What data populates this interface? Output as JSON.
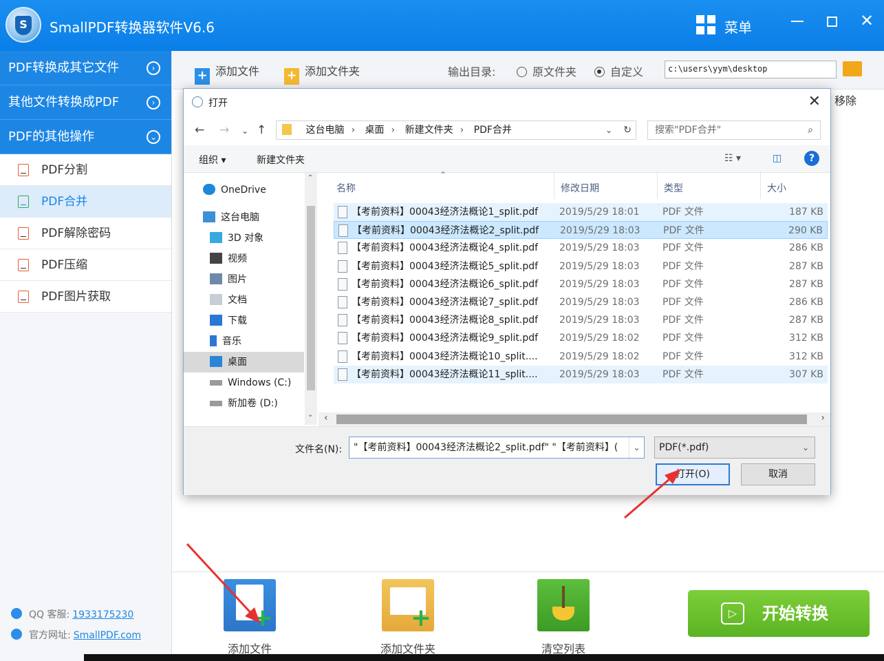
{
  "app": {
    "title": "SmallPDF转换器软件V6.6",
    "logo_letter": "S",
    "menu_label": "菜单",
    "close_glyph": "✕"
  },
  "sidebar": {
    "categories": [
      {
        "label": "PDF转换成其它文件",
        "icon": "chevron-right-circle"
      },
      {
        "label": "其他文件转换成PDF",
        "icon": "chevron-right-circle"
      },
      {
        "label": "PDF的其他操作",
        "icon": "chevron-down-circle"
      }
    ],
    "items": [
      {
        "label": "PDF分割"
      },
      {
        "label": "PDF合并",
        "active": true
      },
      {
        "label": "PDF解除密码"
      },
      {
        "label": "PDF压缩"
      },
      {
        "label": "PDF图片获取"
      }
    ],
    "qq_label": "QQ 客服:",
    "qq_value": "1933175230",
    "site_label": "官方网址:",
    "site_value": "SmallPDF.com"
  },
  "toolbar": {
    "add_file": "添加文件",
    "add_folder": "添加文件夹",
    "output_label": "输出目录:",
    "option_original": "原文件夹",
    "option_custom": "自定义",
    "custom_selected": true,
    "output_path": "c:\\users\\yym\\desktop",
    "remove_header": "移除"
  },
  "bottom": {
    "add_file": "添加文件",
    "add_folder": "添加文件夹",
    "clear_list": "清空列表",
    "start": "开始转换"
  },
  "dialog": {
    "title": "打开",
    "breadcrumb": [
      "这台电脑",
      "桌面",
      "新建文件夹",
      "PDF合并"
    ],
    "search_placeholder": "搜索\"PDF合并\"",
    "organize": "组织 ▾",
    "new_folder": "新建文件夹",
    "nav_items": [
      {
        "label": "OneDrive",
        "icon": "cloud-icon",
        "color": "#1e88d8"
      },
      {
        "label": "这台电脑",
        "icon": "computer-icon",
        "color": "#3d8fd6"
      },
      {
        "label": "3D 对象",
        "icon": "cube-icon",
        "color": "#36a9e0"
      },
      {
        "label": "视频",
        "icon": "film-icon",
        "color": "#444444"
      },
      {
        "label": "图片",
        "icon": "picture-icon",
        "color": "#6d8aa8"
      },
      {
        "label": "文档",
        "icon": "document-icon",
        "color": "#8a98a8"
      },
      {
        "label": "下载",
        "icon": "download-icon",
        "color": "#2b78d4"
      },
      {
        "label": "音乐",
        "icon": "music-icon",
        "color": "#2b78d4"
      },
      {
        "label": "桌面",
        "icon": "desktop-icon",
        "color": "#2b84d8",
        "selected": true
      },
      {
        "label": "Windows (C:)",
        "icon": "drive-icon",
        "color": "#7a7a7a"
      },
      {
        "label": "新加卷 (D:)",
        "icon": "drive-icon",
        "color": "#7a7a7a"
      }
    ],
    "columns": {
      "name": "名称",
      "date": "修改日期",
      "type": "类型",
      "size": "大小"
    },
    "files": [
      {
        "name": "【考前资料】00043经济法概论1_split.pdf",
        "date": "2019/5/29 18:01",
        "type": "PDF 文件",
        "size": "187 KB",
        "state": "hover"
      },
      {
        "name": "【考前资料】00043经济法概论2_split.pdf",
        "date": "2019/5/29 18:03",
        "type": "PDF 文件",
        "size": "290 KB",
        "state": "selected"
      },
      {
        "name": "【考前资料】00043经济法概论4_split.pdf",
        "date": "2019/5/29 18:03",
        "type": "PDF 文件",
        "size": "286 KB",
        "state": ""
      },
      {
        "name": "【考前资料】00043经济法概论5_split.pdf",
        "date": "2019/5/29 18:03",
        "type": "PDF 文件",
        "size": "287 KB",
        "state": ""
      },
      {
        "name": "【考前资料】00043经济法概论6_split.pdf",
        "date": "2019/5/29 18:03",
        "type": "PDF 文件",
        "size": "287 KB",
        "state": ""
      },
      {
        "name": "【考前资料】00043经济法概论7_split.pdf",
        "date": "2019/5/29 18:03",
        "type": "PDF 文件",
        "size": "286 KB",
        "state": ""
      },
      {
        "name": "【考前资料】00043经济法概论8_split.pdf",
        "date": "2019/5/29 18:03",
        "type": "PDF 文件",
        "size": "287 KB",
        "state": ""
      },
      {
        "name": "【考前资料】00043经济法概论9_split.pdf",
        "date": "2019/5/29 18:02",
        "type": "PDF 文件",
        "size": "312 KB",
        "state": ""
      },
      {
        "name": "【考前资料】00043经济法概论10_split....",
        "date": "2019/5/29 18:02",
        "type": "PDF 文件",
        "size": "312 KB",
        "state": ""
      },
      {
        "name": "【考前资料】00043经济法概论11_split....",
        "date": "2019/5/29 18:03",
        "type": "PDF 文件",
        "size": "307 KB",
        "state": "hover"
      }
    ],
    "filename_label": "文件名(N):",
    "filename_value": "\"【考前资料】00043经济法概论2_split.pdf\" \"【考前资料】(",
    "filetype": "PDF(*.pdf)",
    "open_button": "打开(O)",
    "cancel_button": "取消"
  },
  "colors": {
    "brand": "#1c86e4",
    "start": "#67bd2b",
    "annotation_arrow": "#e8312f"
  }
}
